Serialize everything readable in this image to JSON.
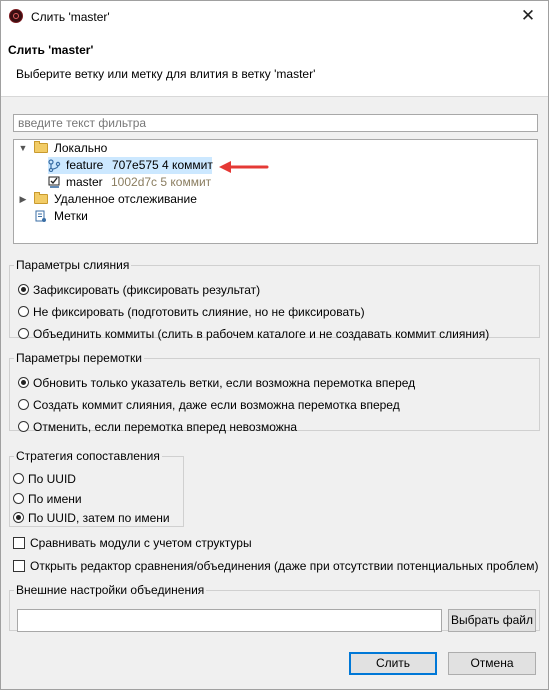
{
  "window": {
    "title": "Слить 'master'",
    "close_glyph": "✕"
  },
  "header": {
    "title": "Слить 'master'",
    "description": "Выберите ветку или метку для влития в ветку 'master'"
  },
  "filter": {
    "placeholder": "введите текст фильтра",
    "value": ""
  },
  "tree": {
    "local": {
      "label": "Локально",
      "expanded": true
    },
    "branches": [
      {
        "name": "feature",
        "info": "707e575 4 коммит",
        "selected": true
      },
      {
        "name": "master",
        "info": "1002d7c 5 коммит",
        "selected": false
      }
    ],
    "remote": {
      "label": "Удаленное отслеживание",
      "expanded": false
    },
    "tags": {
      "label": "Метки"
    }
  },
  "merge_options": {
    "title": "Параметры слияния",
    "options": [
      {
        "label": "Зафиксировать (фиксировать результат)",
        "selected": true
      },
      {
        "label": "Не фиксировать (подготовить слияние, но не фиксировать)",
        "selected": false
      },
      {
        "label": "Объединить коммиты (слить в рабочем каталоге и не создавать коммит слияния)",
        "selected": false
      }
    ]
  },
  "ff_options": {
    "title": "Параметры перемотки",
    "options": [
      {
        "label": "Обновить только указатель ветки, если возможна перемотка вперед",
        "selected": true
      },
      {
        "label": "Создать коммит слияния, даже если возможна перемотка вперед",
        "selected": false
      },
      {
        "label": "Отменить, если перемотка вперед невозможна",
        "selected": false
      }
    ]
  },
  "strategy": {
    "title": "Стратегия сопоставления",
    "options": [
      {
        "label": "По UUID",
        "selected": false
      },
      {
        "label": "По имени",
        "selected": false
      },
      {
        "label": "По UUID, затем по имени",
        "selected": true
      }
    ]
  },
  "checkboxes": {
    "structural_compare": {
      "label": "Сравнивать модули с учетом структуры",
      "checked": false
    },
    "open_merge_editor": {
      "label": "Открыть редактор сравнения/объединения (даже при отсутствии потенциальных проблем)",
      "checked": false
    }
  },
  "external": {
    "title": "Внешние настройки объединения",
    "value": "",
    "browse_label": "Выбрать файл"
  },
  "footer": {
    "ok_label": "Слить",
    "cancel_label": "Отмена"
  },
  "colors": {
    "selection": "#cce8ff",
    "arrow": "#e53935",
    "accent": "#0078d7",
    "body_bg": "#f0f0f0"
  },
  "icons": {
    "app": "app-icon",
    "folder": "folder-icon",
    "branch": "branch-icon",
    "tag": "tag-icon"
  }
}
